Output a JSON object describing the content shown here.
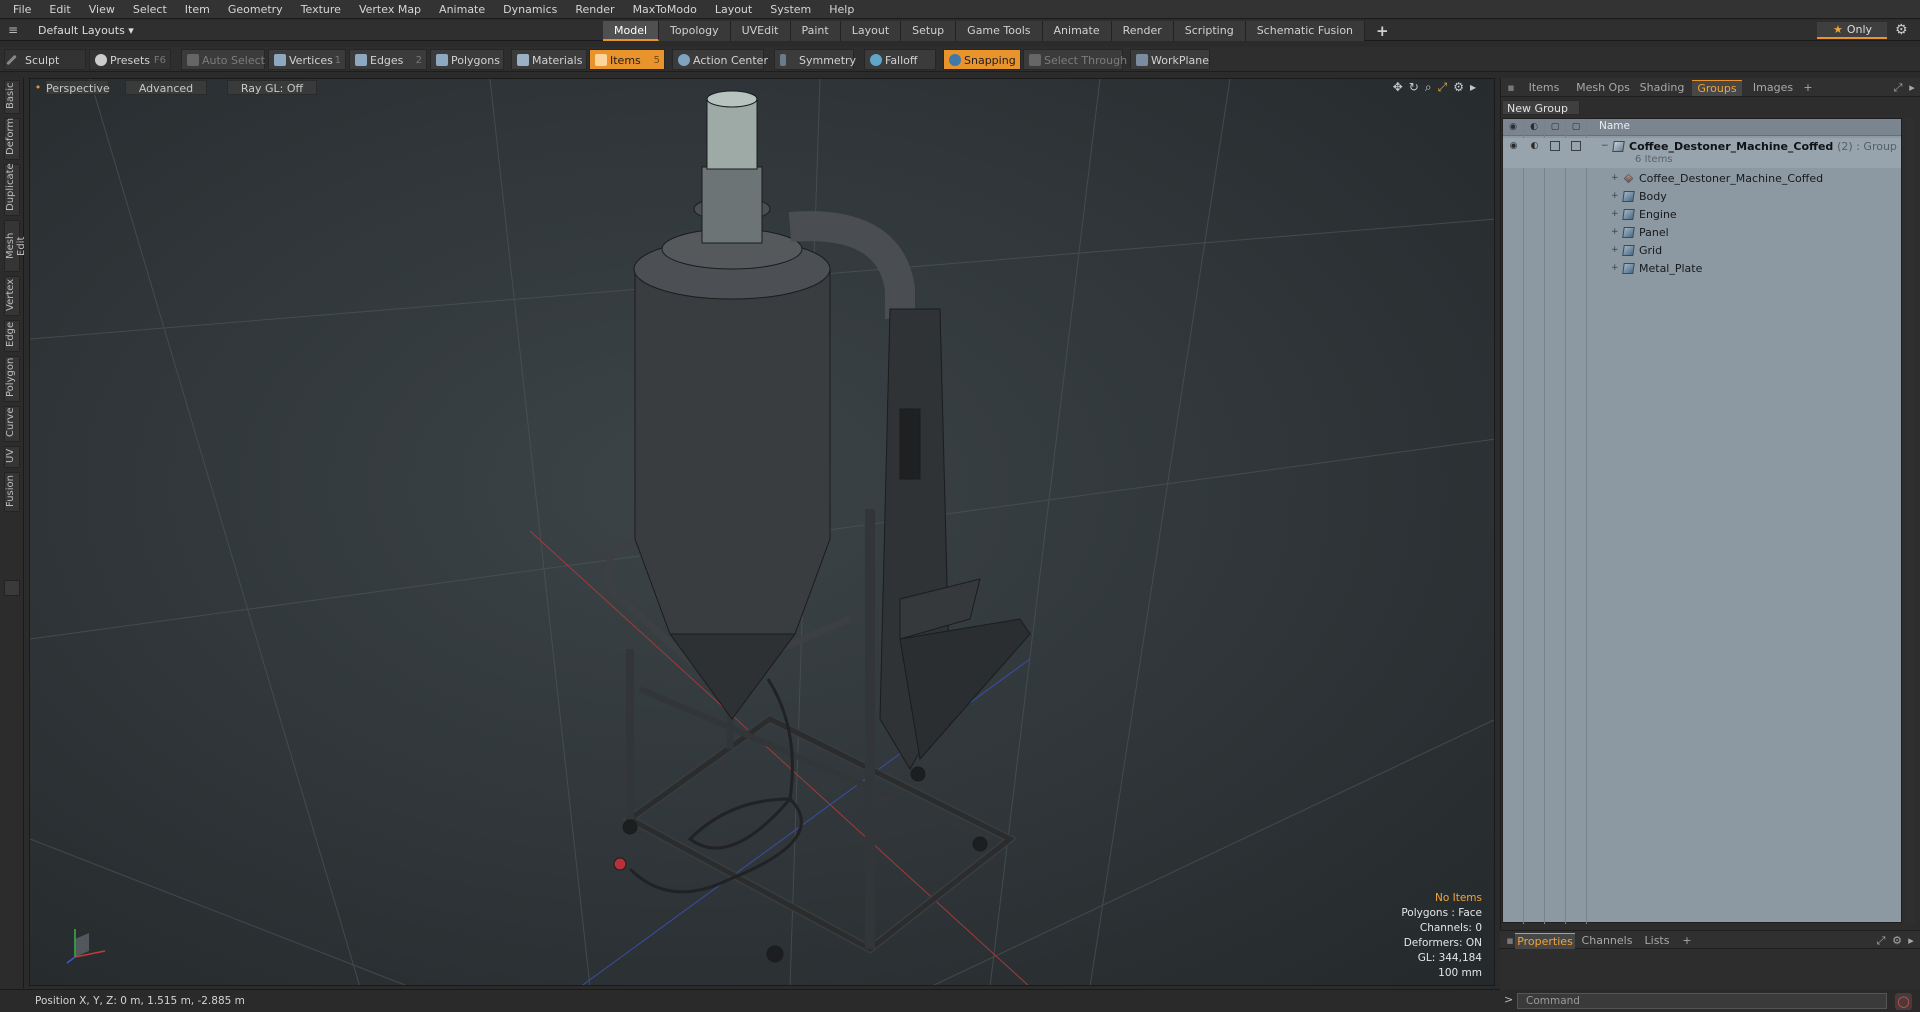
{
  "menu": [
    "File",
    "Edit",
    "View",
    "Select",
    "Item",
    "Geometry",
    "Texture",
    "Vertex Map",
    "Animate",
    "Dynamics",
    "Render",
    "MaxToModo",
    "Layout",
    "System",
    "Help"
  ],
  "layouts_label": "Default Layouts ▾",
  "mode_tabs": [
    "Model",
    "Topology",
    "UVEdit",
    "Paint",
    "Layout",
    "Setup",
    "Game Tools",
    "Animate",
    "Render",
    "Scripting",
    "Schematic Fusion"
  ],
  "active_mode_tab": "Model",
  "only_label": "Only",
  "toolbar": {
    "sculpt": "Sculpt",
    "presets": "Presets",
    "presets_key": "F6",
    "auto_select": "Auto Select",
    "vertices": "Vertices",
    "vertices_count": "1",
    "edges": "Edges",
    "edges_count": "2",
    "polygons": "Polygons",
    "materials": "Materials",
    "items": "Items",
    "items_count": "5",
    "action_center": "Action Center",
    "symmetry": "Symmetry",
    "falloff": "Falloff",
    "snapping": "Snapping",
    "select_through": "Select Through",
    "workplane": "WorkPlane"
  },
  "left_tabs": [
    "Basic",
    "Deform",
    "Duplicate",
    "Mesh Edit",
    "Vertex",
    "Edge",
    "Polygon",
    "Curve",
    "UV",
    "Fusion"
  ],
  "viewport": {
    "perspective": "Perspective",
    "advanced": "Advanced",
    "raygl": "Ray GL: Off",
    "stats": {
      "items": "No Items",
      "polygons": "Polygons : Face",
      "channels": "Channels: 0",
      "deformers": "Deformers: ON",
      "gl": "GL: 344,184",
      "scale": "100 mm"
    }
  },
  "status": "Position X, Y, Z:  0 m, 1.515 m, -2.885 m",
  "right_panel": {
    "tabs": [
      "Items",
      "Mesh Ops",
      "Shading",
      "Groups",
      "Images"
    ],
    "active_tab": "Groups",
    "new_group": "New Group",
    "column_name": "Name",
    "group": {
      "name": "Coffee_Destoner_Machine_Coffed",
      "suffix": "(2) : Group",
      "count": "6 Items"
    },
    "items": [
      "Coffee_Destoner_Machine_Coffed",
      "Body",
      "Engine",
      "Panel",
      "Grid",
      "Metal_Plate"
    ]
  },
  "bottom_tabs": [
    "Properties",
    "Channels",
    "Lists"
  ],
  "active_bottom_tab": "Properties",
  "command_placeholder": "Command",
  "colors": {
    "accent": "#e8932b",
    "outliner_bg": "#8c98a2",
    "viewport_bg": "#333a3d"
  }
}
